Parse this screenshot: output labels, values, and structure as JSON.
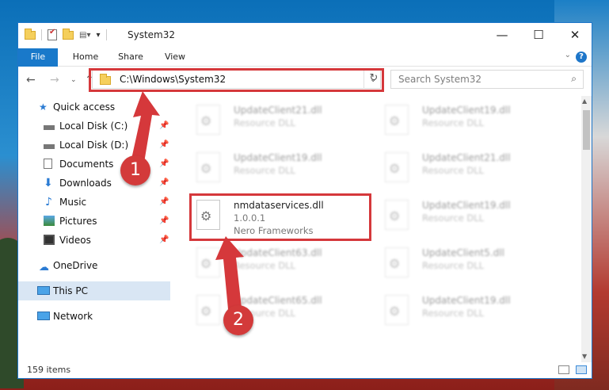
{
  "window": {
    "title": "System32",
    "controls": {
      "minimize": "—",
      "maximize": "☐",
      "close": "✕"
    }
  },
  "ribbon": {
    "tabs": [
      "File",
      "Home",
      "Share",
      "View"
    ],
    "help": "?"
  },
  "navigation": {
    "address": "C:\\Windows\\System32",
    "search_placeholder": "Search System32"
  },
  "sidebar": {
    "items": [
      {
        "label": "Quick access",
        "icon": "star-icon",
        "pinned": false
      },
      {
        "label": "Local Disk (C:)",
        "icon": "drive-icon",
        "pinned": true
      },
      {
        "label": "Local Disk (D:)",
        "icon": "drive-icon",
        "pinned": true
      },
      {
        "label": "Documents",
        "icon": "documents-icon",
        "pinned": true
      },
      {
        "label": "Downloads",
        "icon": "download-icon",
        "pinned": true
      },
      {
        "label": "Music",
        "icon": "music-icon",
        "pinned": true
      },
      {
        "label": "Pictures",
        "icon": "pictures-icon",
        "pinned": true
      },
      {
        "label": "Videos",
        "icon": "videos-icon",
        "pinned": true
      },
      {
        "label": "OneDrive",
        "icon": "cloud-icon",
        "pinned": false
      },
      {
        "label": "This PC",
        "icon": "pc-icon",
        "pinned": false
      },
      {
        "label": "Network",
        "icon": "network-icon",
        "pinned": false
      }
    ]
  },
  "files": [
    {
      "name": "UpdateClient21.dll",
      "line2": "Resource DLL",
      "line3": ""
    },
    {
      "name": "UpdateClient19.dll",
      "line2": "Resource DLL",
      "line3": ""
    },
    {
      "name": "UpdateClient19.dll",
      "line2": "Resource DLL",
      "line3": ""
    },
    {
      "name": "UpdateClient21.dll",
      "line2": "Resource DLL",
      "line3": ""
    },
    {
      "name": "nmdataservices.dll",
      "line2": "1.0.0.1",
      "line3": "Nero Frameworks"
    },
    {
      "name": "UpdateClient19.dll",
      "line2": "Resource DLL",
      "line3": ""
    },
    {
      "name": "UpdateClient63.dll",
      "line2": "Resource DLL",
      "line3": ""
    },
    {
      "name": "UpdateClient5.dll",
      "line2": "Resource DLL",
      "line3": ""
    },
    {
      "name": "UpdateClient65.dll",
      "line2": "Resource DLL",
      "line3": ""
    },
    {
      "name": "UpdateClient19.dll",
      "line2": "Resource DLL",
      "line3": ""
    }
  ],
  "status": {
    "item_count": "159 items"
  },
  "annotations": {
    "step1": "1",
    "step2": "2",
    "color": "#d5383b"
  }
}
